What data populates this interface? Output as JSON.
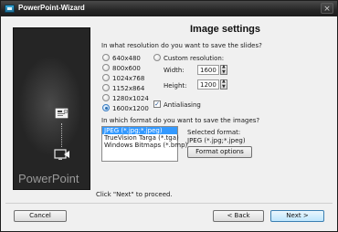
{
  "window": {
    "title": "PowerPoint-Wizard",
    "close_glyph": "×"
  },
  "panel": {
    "brand": "PowerPoint"
  },
  "heading": "Image settings",
  "resolution": {
    "question": "In what resolution do you want to save the slides?",
    "options": [
      "640x480",
      "800x600",
      "1024x768",
      "1152x864",
      "1280x1024",
      "1600x1200"
    ],
    "selected": "1600x1200",
    "custom_label": "Custom resolution:",
    "width_label": "Width:",
    "width_value": "1600",
    "height_label": "Height:",
    "height_value": "1200",
    "antialiasing_label": "Antialiasing",
    "antialiasing_checked": true,
    "check_glyph": "✓"
  },
  "format": {
    "question": "In which format do you want to save the images?",
    "items": [
      "JPEG (*.jpg;*.jpeg)",
      "TrueVision Targa (*.tga)",
      "Windows Bitmaps (*.bmp)"
    ],
    "selected": "JPEG (*.jpg;*.jpeg)",
    "selected_format_label": "Selected format:",
    "selected_format_value": "JPEG (*.jpg;*.jpeg)",
    "options_button": "Format options"
  },
  "hint": "Click \"Next\" to proceed.",
  "footer": {
    "cancel": "Cancel",
    "back": "< Back",
    "next": "Next >"
  },
  "colors": {
    "titlebar": "#262626",
    "panel": "#252525",
    "selection": "#3399ff"
  }
}
